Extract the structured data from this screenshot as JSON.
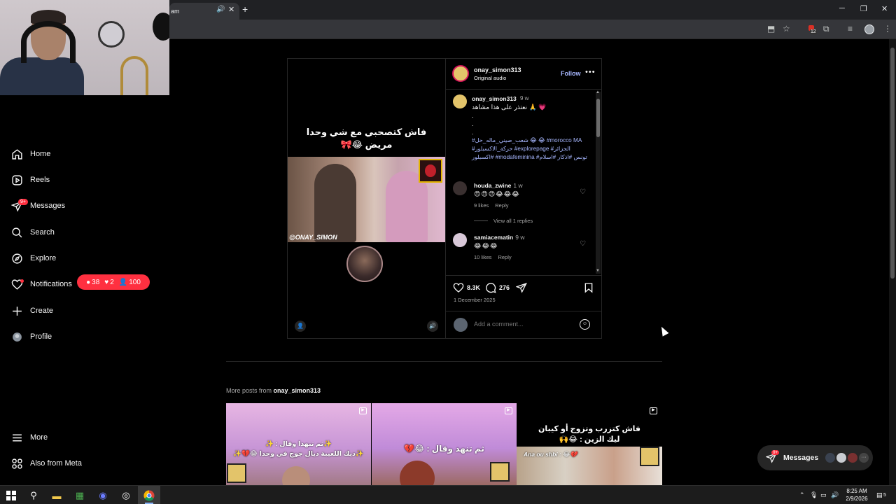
{
  "browser": {
    "tab_title": "am",
    "tab_audio_icon": "speaker-icon",
    "tab_close": "✕",
    "new_tab": "+",
    "window_controls": [
      "─",
      "❐",
      "✕"
    ],
    "extension_badge": "12"
  },
  "nav": {
    "items": [
      {
        "label": "Home",
        "icon": "home-icon"
      },
      {
        "label": "Reels",
        "icon": "reels-icon"
      },
      {
        "label": "Messages",
        "icon": "messages-icon",
        "badge": "9+"
      },
      {
        "label": "Search",
        "icon": "search-icon"
      },
      {
        "label": "Explore",
        "icon": "explore-icon"
      },
      {
        "label": "Notifications",
        "icon": "heart-icon"
      },
      {
        "label": "Create",
        "icon": "plus-icon"
      },
      {
        "label": "Profile",
        "icon": "profile-avatar"
      }
    ],
    "bottom": [
      {
        "label": "More",
        "icon": "menu-icon"
      },
      {
        "label": "Also from Meta",
        "icon": "meta-icon"
      }
    ],
    "notification_pill": {
      "comments": "38",
      "likes": "2",
      "followers": "100"
    }
  },
  "post": {
    "owner": "onay_simon313",
    "audio": "Original audio",
    "follow_label": "Follow",
    "more": "•••",
    "media": {
      "caption_line1": "فاش كتصحبي مع شي وحدا",
      "caption_line2": "مريض 😂🎀",
      "watermark": "@ONAY_SIMON"
    },
    "caption": {
      "user": "onay_simon313",
      "time": "9 w",
      "text": "نعتذر على هذا مشاهد 🙏 💗",
      "dots": [
        ".",
        ".",
        "."
      ],
      "tags": "#شعب_صيني_ماله_حل 😂 😂 #morocco MA #حركة_الاكسبلور #explorepage #الجزائر #اكسبلور #modafeminina #تونس #اذكار #اسلام"
    },
    "comments": [
      {
        "user": "houda_zwine",
        "time": "1 w",
        "text": "😍😍😍😂😂😂",
        "likes": "9 likes",
        "reply": "Reply",
        "view_replies": "View all 1 replies"
      },
      {
        "user": "samiacematin",
        "time": "9 w",
        "text": "😂😂😂",
        "likes": "10 likes",
        "reply": "Reply"
      }
    ],
    "like_count": "8.3K",
    "comment_count": "276",
    "date": "1 December 2025",
    "add_comment_placeholder": "Add a comment..."
  },
  "more_posts": {
    "prefix": "More posts from ",
    "user": "onay_simon313",
    "thumbs": [
      {
        "text1": "✨ثم تنهدا وقال : ✨",
        "text2": "✨ديك اللعيبة ديال جوج في وحدا 😂💔✨"
      },
      {
        "text1": "ثم تنهد وقال : 😂💔"
      },
      {
        "text1": "فاش كتزرب وتزوج أو كيبان",
        "text2": "ليك الزين : 😂🙌",
        "text3": "Ana ou shbi : 😂💔"
      }
    ]
  },
  "messages_float": {
    "label": "Messages",
    "badge": "9+"
  },
  "taskbar": {
    "time": "8:25 AM",
    "date": "2/9/2026",
    "notif_count": "5"
  }
}
